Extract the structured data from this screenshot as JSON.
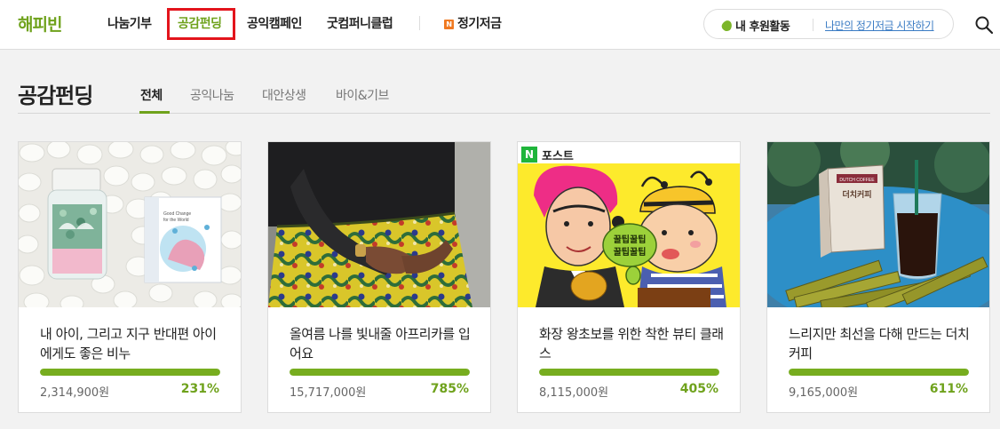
{
  "nav": {
    "logo": "해피빈",
    "items": [
      {
        "label": "나눔기부",
        "active": false
      },
      {
        "label": "공감펀딩",
        "active": true
      },
      {
        "label": "공익캠페인",
        "active": false
      },
      {
        "label": "굿컴퍼니클럽",
        "active": false
      }
    ],
    "regular": {
      "badge": "N",
      "label": "정기저금"
    },
    "my_activity": "내 후원활동",
    "start_link": "나만의 정기저금 시작하기",
    "search_icon": "search-icon"
  },
  "section": {
    "title": "공감펀딩",
    "tabs": [
      {
        "label": "전체",
        "active": true
      },
      {
        "label": "공익나눔",
        "active": false
      },
      {
        "label": "대안상생",
        "active": false
      },
      {
        "label": "바이&기브",
        "active": false
      }
    ]
  },
  "cards": [
    {
      "title": "내 아이, 그리고 지구 반대편 아이에게도 좋은 비누",
      "amount": "2,314,900원",
      "percent": "231%",
      "progress": 1.0,
      "image": "soap-product-photo",
      "image_text": [
        "Good Change",
        "for the World"
      ]
    },
    {
      "title": "올여름 나를 빛내줄 아프리카를 입어요",
      "amount": "15,717,000원",
      "percent": "785%",
      "progress": 1.0,
      "image": "african-print-skirt-photo"
    },
    {
      "title": "화장 왕초보를 위한 착한 뷰티 클래스",
      "amount": "8,115,000원",
      "percent": "405%",
      "progress": 1.0,
      "image": "beauty-class-cartoon",
      "badge": {
        "letter": "N",
        "label": "포스트"
      },
      "bubble": [
        "꿀팁꿀팁",
        "꿀팁꿀팁"
      ]
    },
    {
      "title": "느리지만 최선을 다해 만드는 더치커피",
      "amount": "9,165,000원",
      "percent": "611%",
      "progress": 1.0,
      "image": "dutch-coffee-photo",
      "image_text": [
        "DUTCH COFFEE",
        "더치커피"
      ]
    }
  ],
  "colors": {
    "accent": "#6fa21c",
    "progress": "#77ad1f",
    "highlight_box": "#e3141c",
    "link": "#3b7cc4"
  }
}
